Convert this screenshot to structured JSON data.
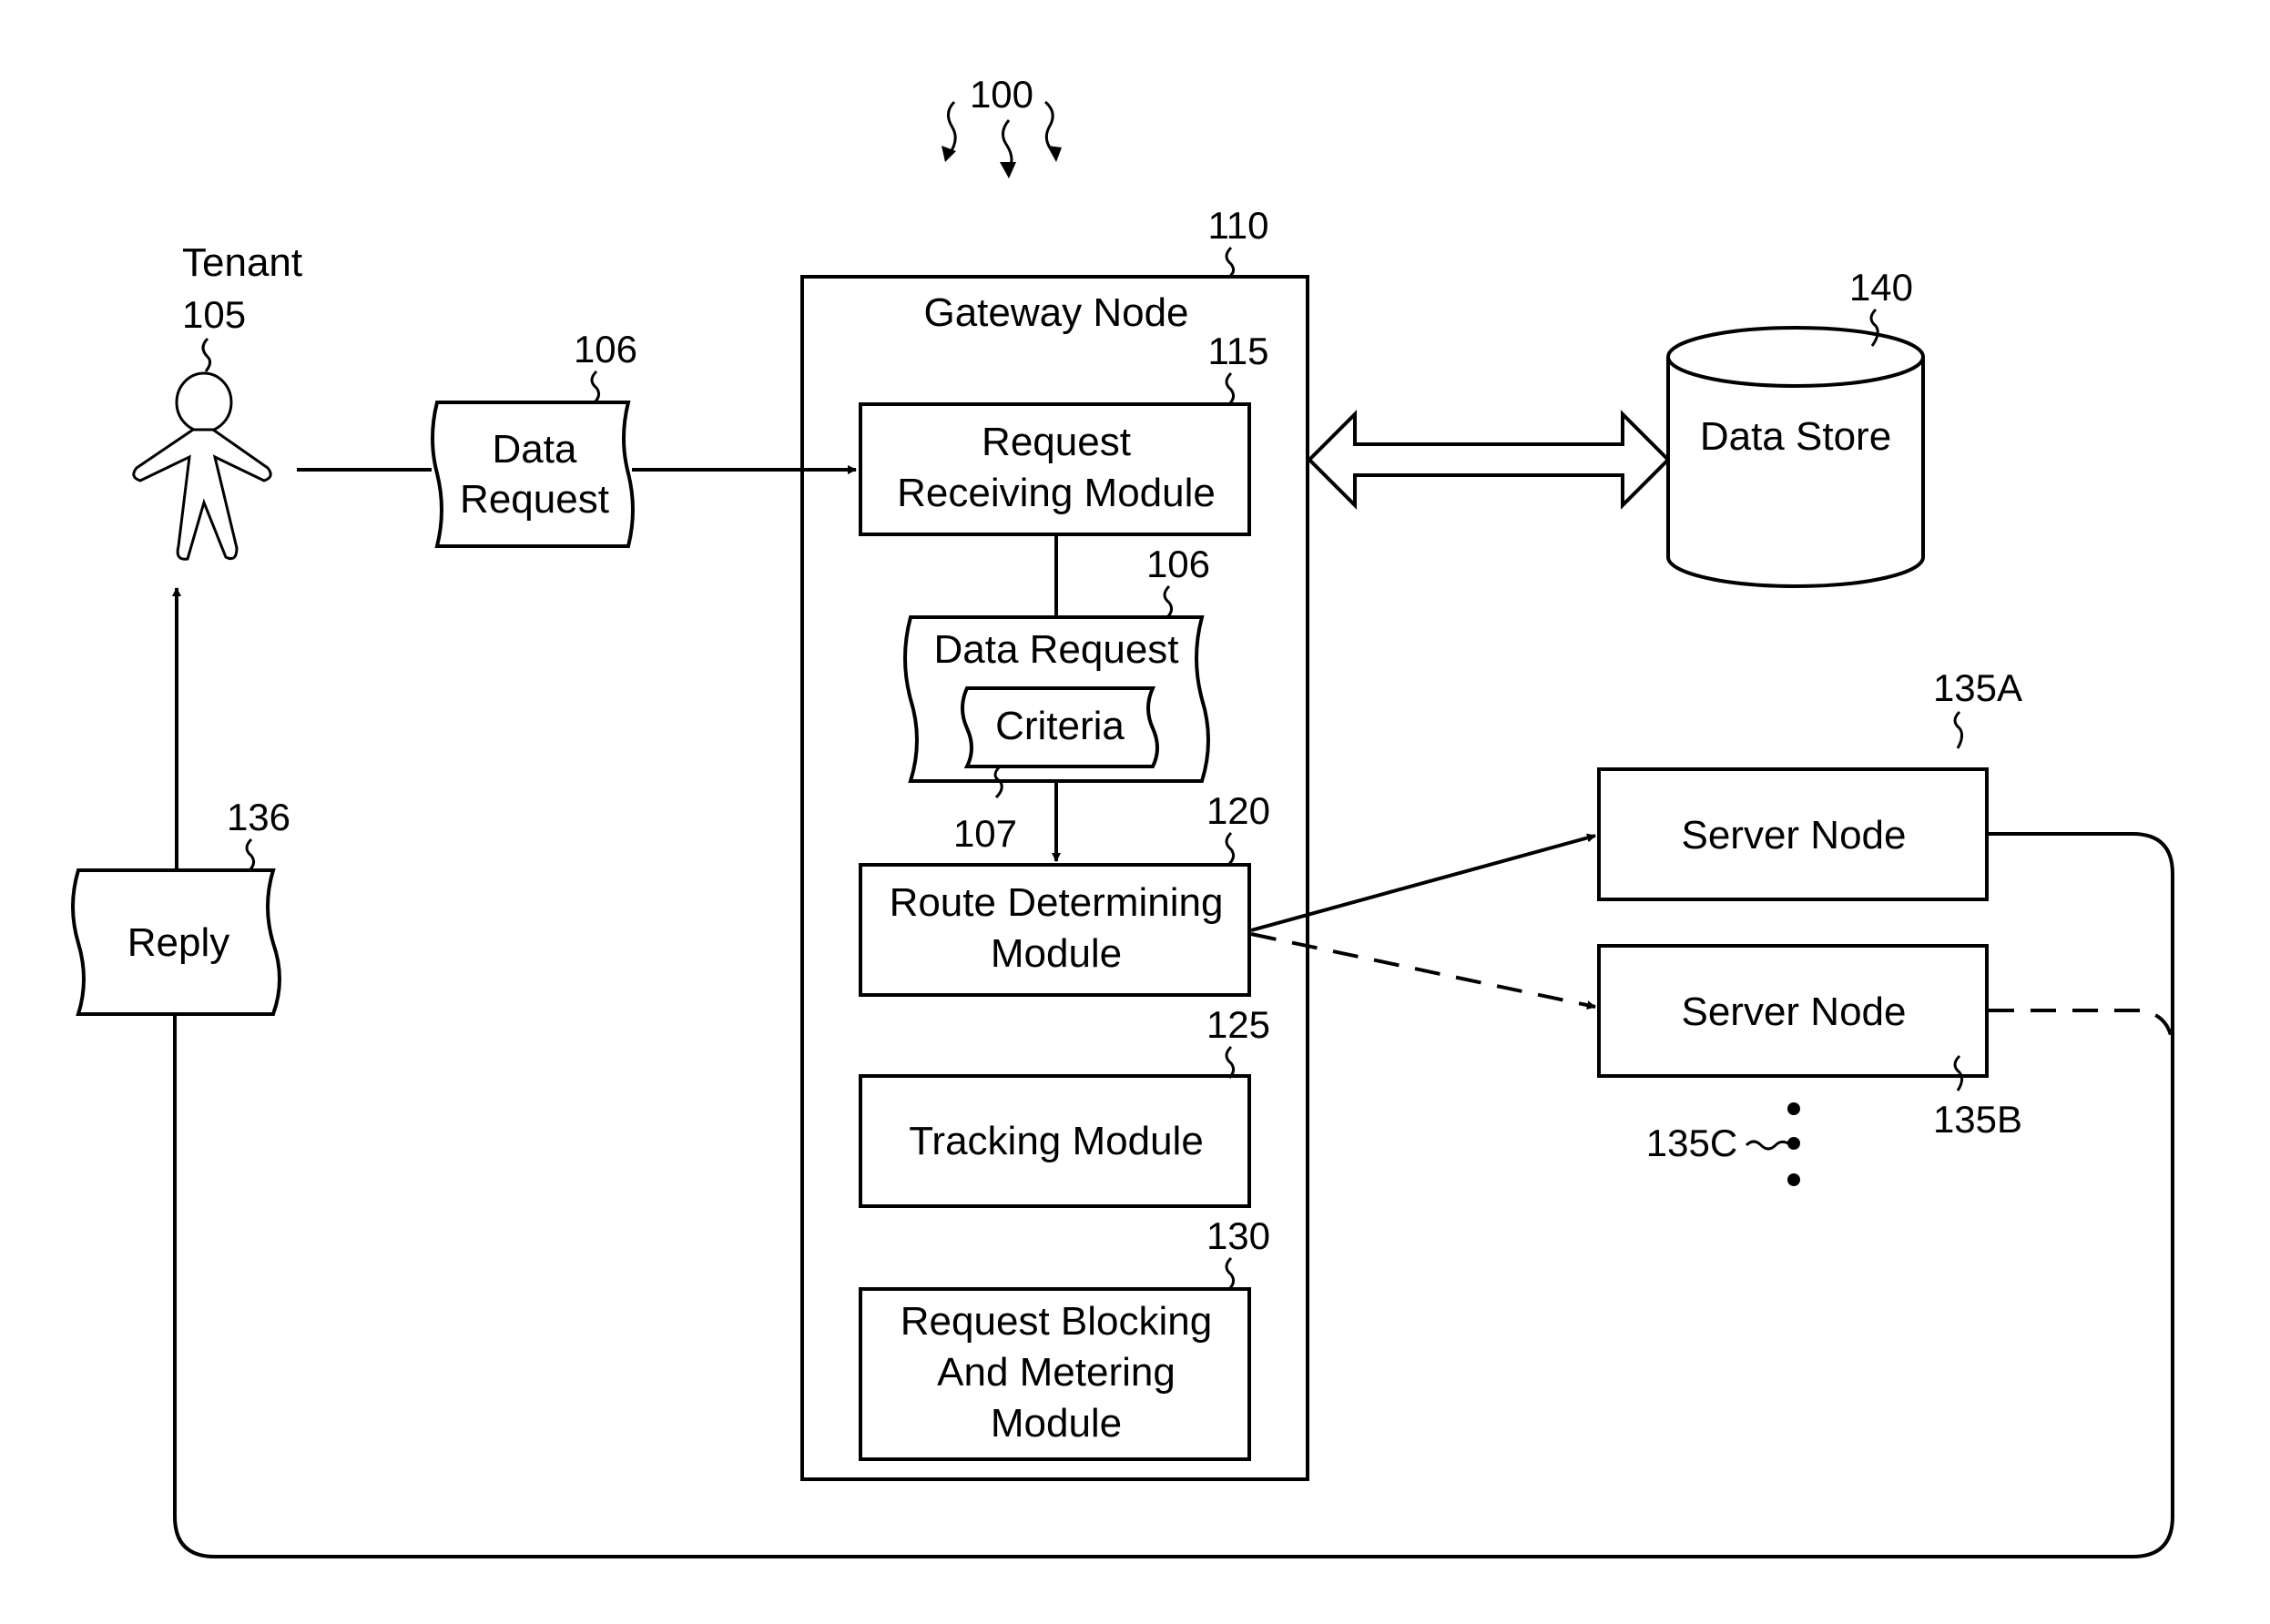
{
  "figure": {
    "ref_number": "100",
    "tenant": {
      "label": "Tenant",
      "ref": "105"
    },
    "data_request_outer": {
      "lines": [
        "Data",
        "Request"
      ],
      "ref": "106"
    },
    "gateway": {
      "label": "Gateway Node",
      "ref": "110"
    },
    "request_receiving": {
      "lines": [
        "Request",
        "Receiving Module"
      ],
      "ref": "115"
    },
    "data_request_inner": {
      "label": "Data Request",
      "ref": "106",
      "criteria_label": "Criteria",
      "criteria_ref": "107"
    },
    "route_determining": {
      "lines": [
        "Route Determining",
        "Module"
      ],
      "ref": "120"
    },
    "tracking": {
      "lines": [
        "Tracking Module"
      ],
      "ref": "125"
    },
    "blocking": {
      "lines": [
        "Request Blocking",
        "And Metering",
        "Module"
      ],
      "ref": "130"
    },
    "data_store": {
      "label": "Data Store",
      "ref": "140"
    },
    "server_a": {
      "label": "Server Node",
      "ref": "135A"
    },
    "server_b": {
      "label": "Server Node",
      "ref": "135B"
    },
    "server_c": {
      "ref": "135C"
    },
    "reply": {
      "label": "Reply",
      "ref": "136"
    }
  }
}
